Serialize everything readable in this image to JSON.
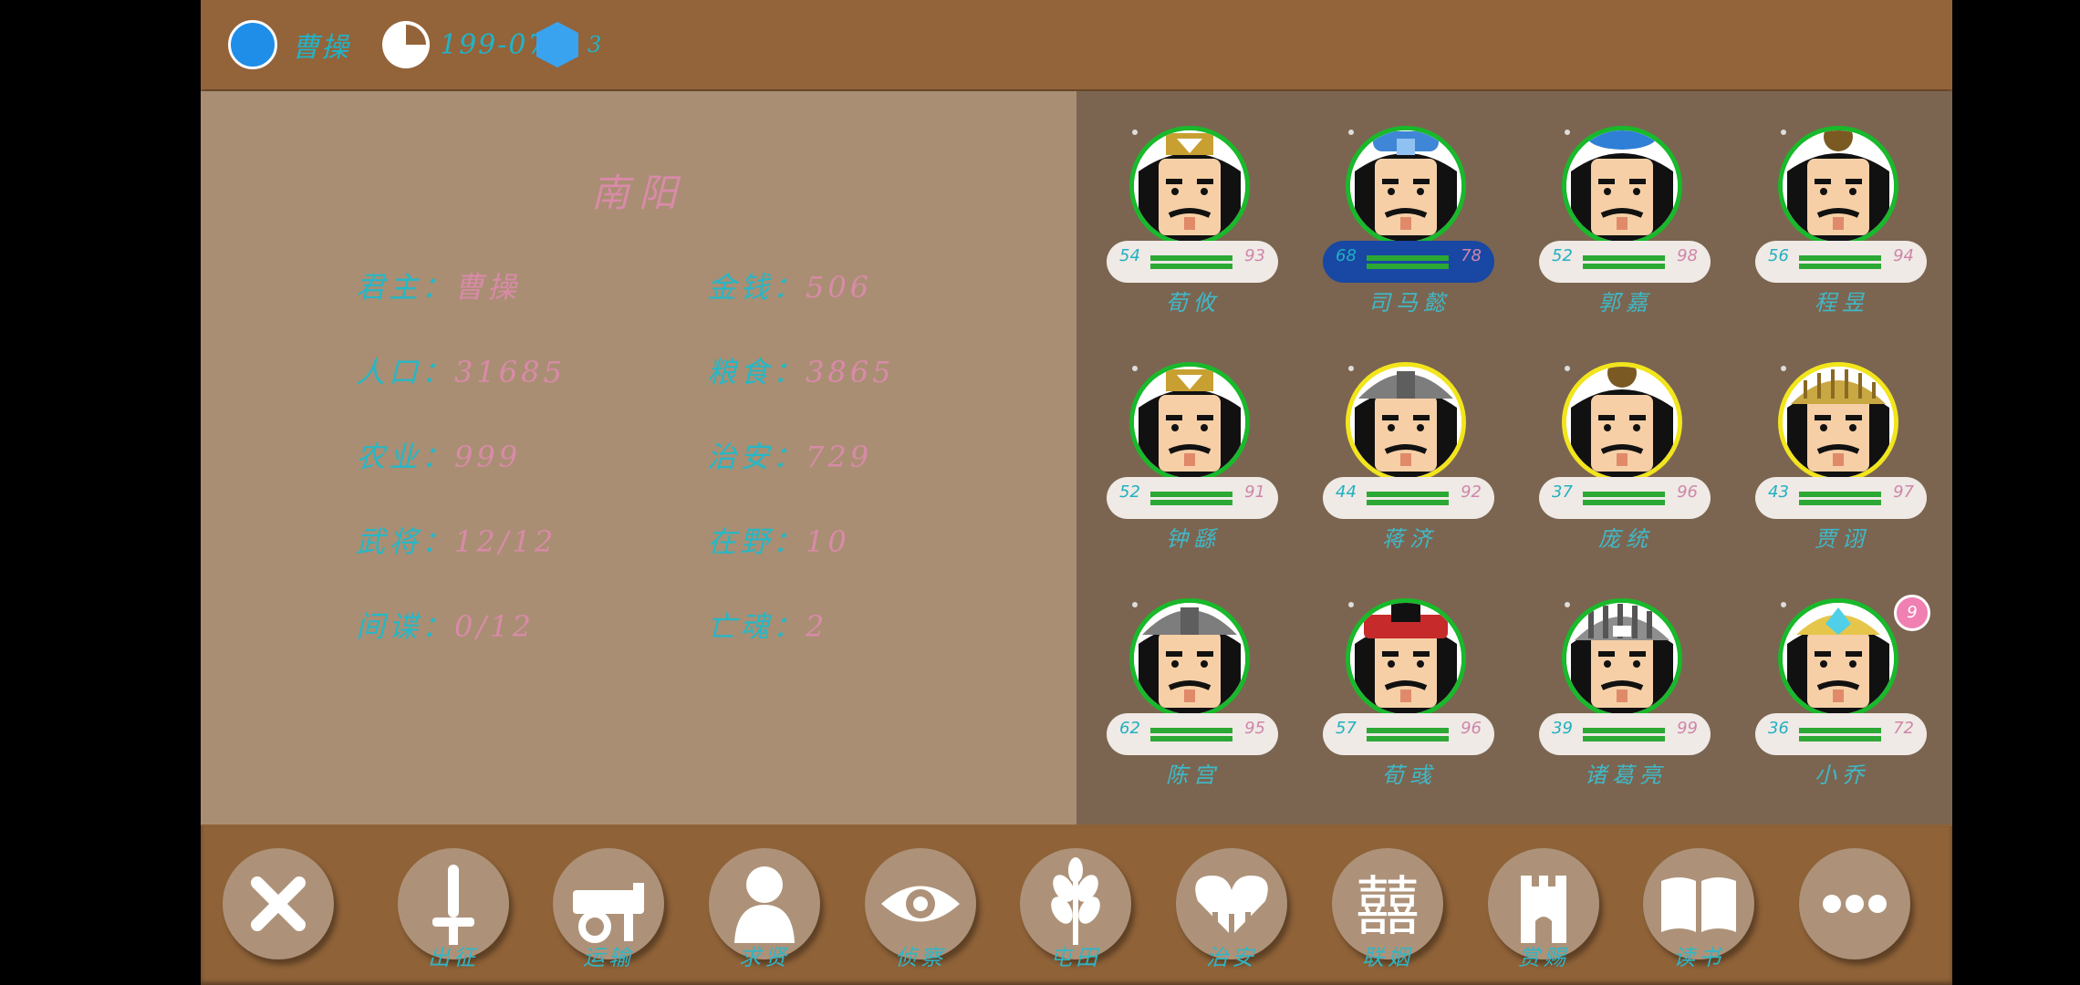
{
  "topbar": {
    "ruler": "曹操",
    "date": "199-07",
    "resource": "3"
  },
  "city": {
    "name": "南阳",
    "stats": [
      {
        "label": "君主：",
        "value": "曹操"
      },
      {
        "label": "金钱：",
        "value": "506"
      },
      {
        "label": "人口：",
        "value": "31685"
      },
      {
        "label": "粮食：",
        "value": "3865"
      },
      {
        "label": "农业：",
        "value": "999"
      },
      {
        "label": "治安：",
        "value": "729"
      },
      {
        "label": "武将：",
        "value": "12/12"
      },
      {
        "label": "在野：",
        "value": "10"
      },
      {
        "label": "间谍：",
        "value": "0/12"
      },
      {
        "label": "亡魂：",
        "value": "2"
      }
    ]
  },
  "officers": [
    {
      "name": "荀攸",
      "left": "54",
      "right": "93",
      "ring": "#18b92a",
      "helmet": "crown_gold"
    },
    {
      "name": "司马懿",
      "left": "68",
      "right": "78",
      "ring": "#18b92a",
      "helmet": "blue_cap",
      "selected": true
    },
    {
      "name": "郭嘉",
      "left": "52",
      "right": "98",
      "ring": "#18b92a",
      "helmet": "blue_round"
    },
    {
      "name": "程昱",
      "left": "56",
      "right": "94",
      "ring": "#18b92a",
      "helmet": "knot"
    },
    {
      "name": "钟繇",
      "left": "52",
      "right": "91",
      "ring": "#18b92a",
      "helmet": "crown_gold"
    },
    {
      "name": "蒋济",
      "left": "44",
      "right": "92",
      "ring": "#f2e51c",
      "helmet": "grey_helm"
    },
    {
      "name": "庞统",
      "left": "37",
      "right": "96",
      "ring": "#f2e51c",
      "helmet": "knot"
    },
    {
      "name": "贾诩",
      "left": "43",
      "right": "97",
      "ring": "#f2e51c",
      "helmet": "gold_helm"
    },
    {
      "name": "陈宫",
      "left": "62",
      "right": "95",
      "ring": "#18b92a",
      "helmet": "grey_helm"
    },
    {
      "name": "荀彧",
      "left": "57",
      "right": "96",
      "ring": "#18b92a",
      "helmet": "red_hat"
    },
    {
      "name": "诸葛亮",
      "left": "39",
      "right": "99",
      "ring": "#18b92a",
      "helmet": "striped"
    },
    {
      "name": "小乔",
      "left": "36",
      "right": "72",
      "ring": "#18b92a",
      "helmet": "girl",
      "badge": "9"
    }
  ],
  "buttons": [
    {
      "icon": "close-icon",
      "label": ""
    },
    {
      "icon": "sword-icon",
      "label": "出征"
    },
    {
      "icon": "cart-icon",
      "label": "运输"
    },
    {
      "icon": "person-icon",
      "label": "求贤"
    },
    {
      "icon": "eye-icon",
      "label": "侦察"
    },
    {
      "icon": "wheat-icon",
      "label": "屯田"
    },
    {
      "icon": "heart-icon",
      "label": "治安"
    },
    {
      "icon": "wedding-icon",
      "label": "联姻"
    },
    {
      "icon": "castle-icon",
      "label": "赏赐"
    },
    {
      "icon": "book-icon",
      "label": "读书"
    },
    {
      "icon": "more-icon",
      "label": ""
    }
  ]
}
